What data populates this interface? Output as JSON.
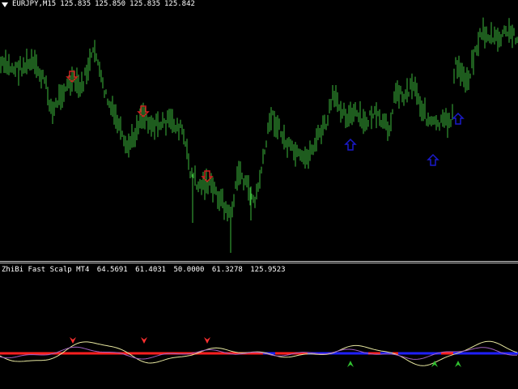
{
  "header": {
    "symbol": "EURJPY,M15",
    "open": "125.835",
    "high": "125.850",
    "low": "125.835",
    "close": "125.842"
  },
  "indicator": {
    "name": "ZhiBi Fast Scalp MT4",
    "values": [
      "64.5691",
      "61.4031",
      "50.0000",
      "61.3278",
      "125.9523"
    ]
  },
  "colors": {
    "candle": "#3cb93c",
    "sell_arrow": "#cc2020",
    "buy_arrow": "#1a1acc",
    "line_red": "#ff2020",
    "line_blue": "#2020ff",
    "osc_yellow": "#e8e8a0",
    "osc_purple": "#a060c0",
    "sell_marker": "#ff3030",
    "buy_marker": "#30c030"
  },
  "icons": {
    "chart_menu": "triangle-down-icon",
    "sell_signal": "down-arrow-icon",
    "buy_signal": "up-arrow-icon"
  }
}
